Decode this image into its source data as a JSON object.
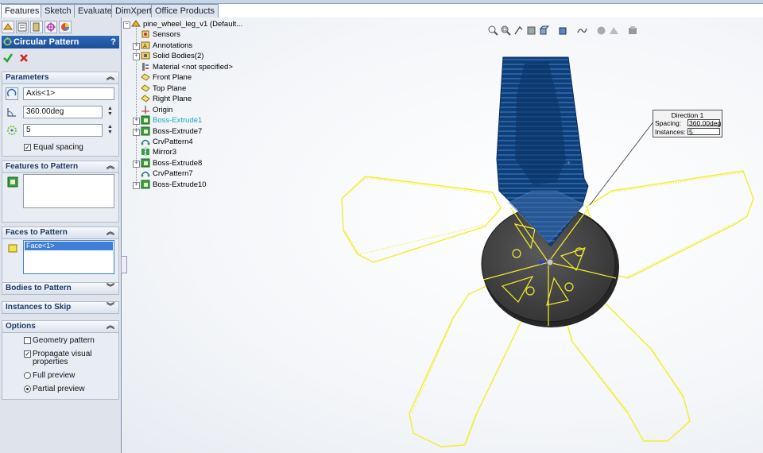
{
  "tabs": [
    "Features",
    "Sketch",
    "Evaluate",
    "DimXpert",
    "Office Products"
  ],
  "property_manager": {
    "title": "Circular Pattern",
    "help": "?",
    "parameters": {
      "header": "Parameters",
      "axis_value": "Axis<1>",
      "angle_value": "360.00deg",
      "instances_value": "5",
      "equal_spacing_label": "Equal spacing",
      "equal_spacing_checked": true
    },
    "features_to_pattern": {
      "header": "Features to Pattern"
    },
    "faces_to_pattern": {
      "header": "Faces to Pattern",
      "item": "Face<1>"
    },
    "bodies_to_pattern": {
      "header": "Bodies to Pattern"
    },
    "instances_to_skip": {
      "header": "Instances to Skip"
    },
    "options": {
      "header": "Options",
      "geometry_pattern": "Geometry pattern",
      "propagate_line1": "Propagate visual",
      "propagate_line2": "properties",
      "full_preview": "Full preview",
      "partial_preview": "Partial preview"
    }
  },
  "tree": [
    {
      "label": "pine_wheel_leg_v1  (Default...",
      "icon": "part-icon",
      "plus": false,
      "highlight": false
    },
    {
      "label": "Sensors",
      "icon": "sensors-icon",
      "plus": false,
      "highlight": false
    },
    {
      "label": "Annotations",
      "icon": "annotations-icon",
      "plus": true,
      "highlight": false
    },
    {
      "label": "Solid Bodies(2)",
      "icon": "solid-bodies-icon",
      "plus": true,
      "highlight": false
    },
    {
      "label": "Material <not specified>",
      "icon": "material-icon",
      "plus": false,
      "highlight": false
    },
    {
      "label": "Front Plane",
      "icon": "plane-icon",
      "plus": false,
      "highlight": false
    },
    {
      "label": "Top Plane",
      "icon": "plane-icon",
      "plus": false,
      "highlight": false
    },
    {
      "label": "Right Plane",
      "icon": "plane-icon",
      "plus": false,
      "highlight": false
    },
    {
      "label": "Origin",
      "icon": "origin-icon",
      "plus": false,
      "highlight": false
    },
    {
      "label": "Boss-Extrude1",
      "icon": "extrude-icon",
      "plus": true,
      "highlight": true
    },
    {
      "label": "Boss-Extrude7",
      "icon": "extrude-icon",
      "plus": true,
      "highlight": false
    },
    {
      "label": "CrvPattern4",
      "icon": "curve-pattern-icon",
      "plus": false,
      "highlight": false
    },
    {
      "label": "Mirror3",
      "icon": "mirror-icon",
      "plus": false,
      "highlight": false
    },
    {
      "label": "Boss-Extrude8",
      "icon": "extrude-icon",
      "plus": true,
      "highlight": false
    },
    {
      "label": "CrvPattern7",
      "icon": "curve-pattern-icon",
      "plus": false,
      "highlight": false
    },
    {
      "label": "Boss-Extrude10",
      "icon": "extrude-icon",
      "plus": true,
      "highlight": false
    }
  ],
  "callout": {
    "title": "Direction 1",
    "spacing_label": "Spacing:",
    "spacing_value": "360.00deg",
    "instances_label": "Instances:",
    "instances_value": "5"
  },
  "colors": {
    "title_bar": "#1b4f98",
    "preview_yellow": "#f2ee2a",
    "model_blue": "#0d3f7a",
    "hub_gray": "#3c3c3c",
    "highlight_cyan": "#1aa5c7"
  }
}
